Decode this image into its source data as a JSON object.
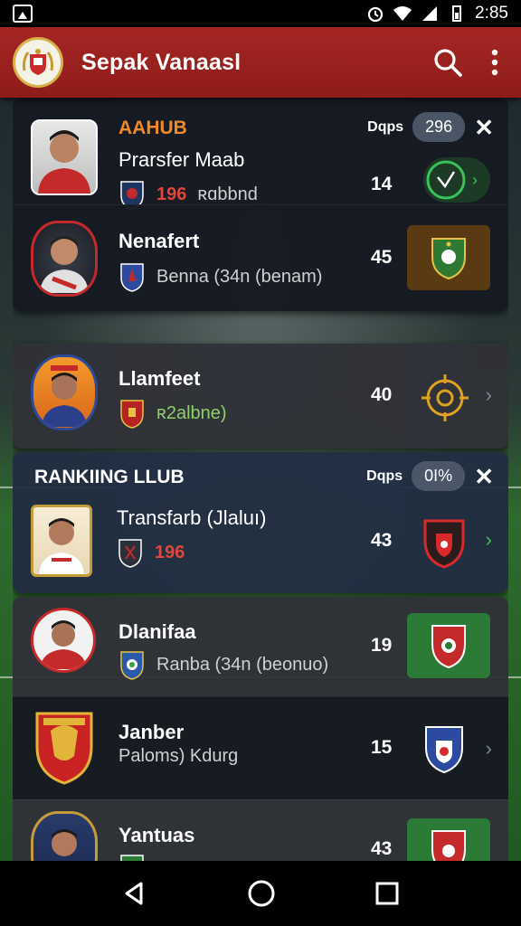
{
  "status_bar": {
    "time": "2:85"
  },
  "app_bar": {
    "title": "Sepak Vanaasl"
  },
  "icons": {
    "logo": "club-crest-icon",
    "search": "search-icon",
    "menu": "more-vert-icon",
    "close": "close-icon",
    "chevron": "chevron-right-icon",
    "back": "back-icon",
    "home": "home-icon",
    "recents": "recents-icon"
  },
  "colors": {
    "app_bar": "#a52623",
    "accent_orange": "#f08a2a",
    "accent_red": "#e0463a",
    "accent_green": "#39c25a"
  },
  "top_header": {
    "label": "AAHUB",
    "pill_text": "Dqps",
    "pill_value": "296"
  },
  "section2_header": {
    "label": "RANKIING LLUB",
    "pill_text": "Dqps",
    "pill_value": "0I%"
  },
  "rows": [
    {
      "name": "Prarsfer Maab",
      "sub_highlight": "196",
      "sub_text": "ʀɑbbnd",
      "number": "14"
    },
    {
      "name": "Nenafert",
      "sub_text": "Benna (34n (benam)",
      "number": "45"
    },
    {
      "name": "Llamfeet",
      "sub_text": "ʀ2albne)",
      "number": "40"
    },
    {
      "name": "Transfarb (Jlaluı)",
      "sub_highlight": "196",
      "number": "43"
    },
    {
      "name": "Dlanifaa",
      "sub_text": "Ranba (34n (beonuo)",
      "number": "19"
    },
    {
      "name": "Janber",
      "sub_text": "Paloms) Kdurg",
      "number": "15"
    },
    {
      "name": "Yantuas",
      "number": "43"
    }
  ]
}
